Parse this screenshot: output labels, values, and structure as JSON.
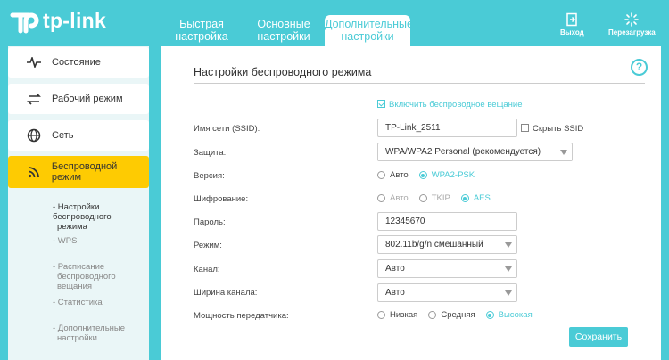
{
  "brand": {
    "logo_text": "tp-link",
    "accent_color": "#4acbd6",
    "active_menu_color": "#fecb02"
  },
  "header": {
    "tabs": [
      {
        "label": "Быстрая настройка",
        "line1": "Быстрая",
        "line2": "настройка"
      },
      {
        "label": "Основные настройки",
        "line1": "Основные",
        "line2": "настройки"
      },
      {
        "label": "Дополнительные настройки",
        "line1": "Дополнительные",
        "line2": "настройки",
        "active": true
      }
    ],
    "logout_label": "Выход",
    "reboot_label": "Перезагрузка",
    "logout_icon": "logout-icon",
    "reboot_icon": "reboot-icon"
  },
  "sidebar": {
    "items": [
      {
        "label": "Состояние",
        "icon": "pulse-icon"
      },
      {
        "label": "Рабочий режим",
        "icon": "exchange-icon"
      },
      {
        "label": "Сеть",
        "icon": "globe-icon"
      },
      {
        "label": "Беспроводной режим",
        "icon": "wireless-icon",
        "active": true
      }
    ],
    "subitems": [
      {
        "line1": "- Настройки беспроводного",
        "line2": "режима",
        "active": true
      },
      {
        "line1": "- WPS",
        "line2": ""
      },
      {
        "line1": "- Расписание",
        "line2": "беспроводного вещания"
      },
      {
        "line1": "- Статистика",
        "line2": ""
      },
      {
        "line1": "- Дополнительные",
        "line2": "настройки"
      }
    ]
  },
  "main": {
    "title": "Настройки беспроводного режима",
    "help_label": "?",
    "enable_broadcast_label": "Включить беспроводное вещание",
    "enable_broadcast_checked": true,
    "ssid": {
      "label": "Имя сети (SSID):",
      "value": "TP-Link_2511",
      "hide_label": "Скрыть SSID",
      "hide_checked": false
    },
    "security": {
      "label": "Защита:",
      "value": "WPA/WPA2 Personal (рекомендуется)"
    },
    "version": {
      "label": "Версия:",
      "options": [
        "Авто",
        "WPA2-PSK"
      ],
      "selected": "WPA2-PSK"
    },
    "encryption": {
      "label": "Шифрование:",
      "options": [
        "Авто",
        "TKIP",
        "AES"
      ],
      "selected": "AES"
    },
    "password": {
      "label": "Пароль:",
      "value": "12345670"
    },
    "mode": {
      "label": "Режим:",
      "value": "802.11b/g/n смешанный"
    },
    "channel": {
      "label": "Канал:",
      "value": "Авто"
    },
    "channel_width": {
      "label": "Ширина канала:",
      "value": "Авто"
    },
    "tx_power": {
      "label": "Мощность передатчика:",
      "options": [
        "Низкая",
        "Средняя",
        "Высокая"
      ],
      "selected": "Высокая"
    },
    "save_label": "Сохранить"
  }
}
